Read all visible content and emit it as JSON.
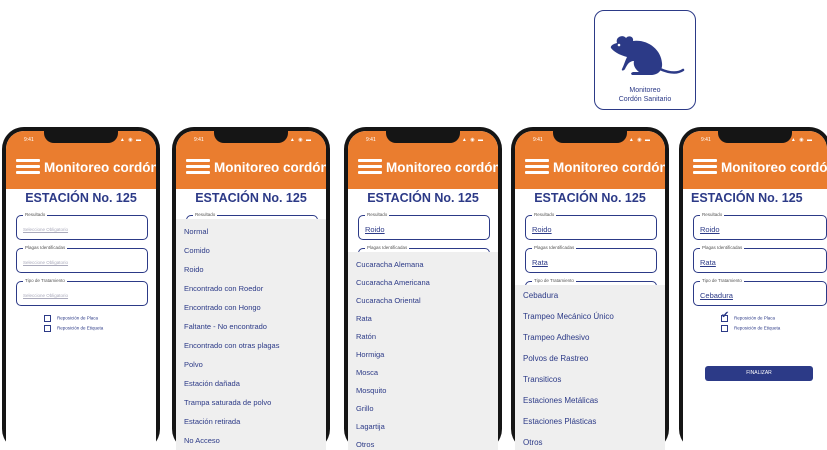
{
  "app": {
    "title": "Monitoreo cordón",
    "station": "ESTACIÓN No. 125",
    "time": "9:41",
    "status": "▲ ◉ ▬"
  },
  "icon_card": {
    "icon": "rat-icon",
    "line1": "Monitoreo",
    "line2": "Cordón Sanitario"
  },
  "labels": {
    "resultado": "Resultado",
    "plagas": "Plagas Identificadas",
    "tratamiento": "Tipo de Tratamiento",
    "placeholder": "Seleccione Obligatorio",
    "reposicion_placa": "Reposición de Placa",
    "reposicion_etiqueta": "Reposición de Etiqueta",
    "finalizar": "FINALIZAR"
  },
  "values": {
    "resultado": "Roido",
    "plagas": "Rata",
    "tratamiento": "Cebadura"
  },
  "resultado_options": [
    "Normal",
    "Comido",
    "Roido",
    "Encontrado con Roedor",
    "Encontrado con Hongo",
    "Faltante - No encontrado",
    "Encontrado con otras plagas",
    "Polvo",
    "Estación dañada",
    "Trampa saturada de polvo",
    "Estación retirada",
    "No Acceso"
  ],
  "plagas_options": [
    "Cucaracha Alemana",
    "Cucaracha Americana",
    "Cucaracha Oriental",
    "Rata",
    "Ratón",
    "Hormiga",
    "Mosca",
    "Mosquito",
    "Grillo",
    "Lagartija",
    "Otros"
  ],
  "tratamiento_options": [
    "Cebadura",
    "Trampeo Mecánico Único",
    "Trampeo Adhesivo",
    "Polvos de Rastreo",
    "Transiticos",
    "Estaciones Metálicas",
    "Estaciones Plásticas",
    "Otros"
  ],
  "colors": {
    "accent": "#ea7d2f",
    "brand": "#2c3a87",
    "list_bg": "#efefef"
  }
}
